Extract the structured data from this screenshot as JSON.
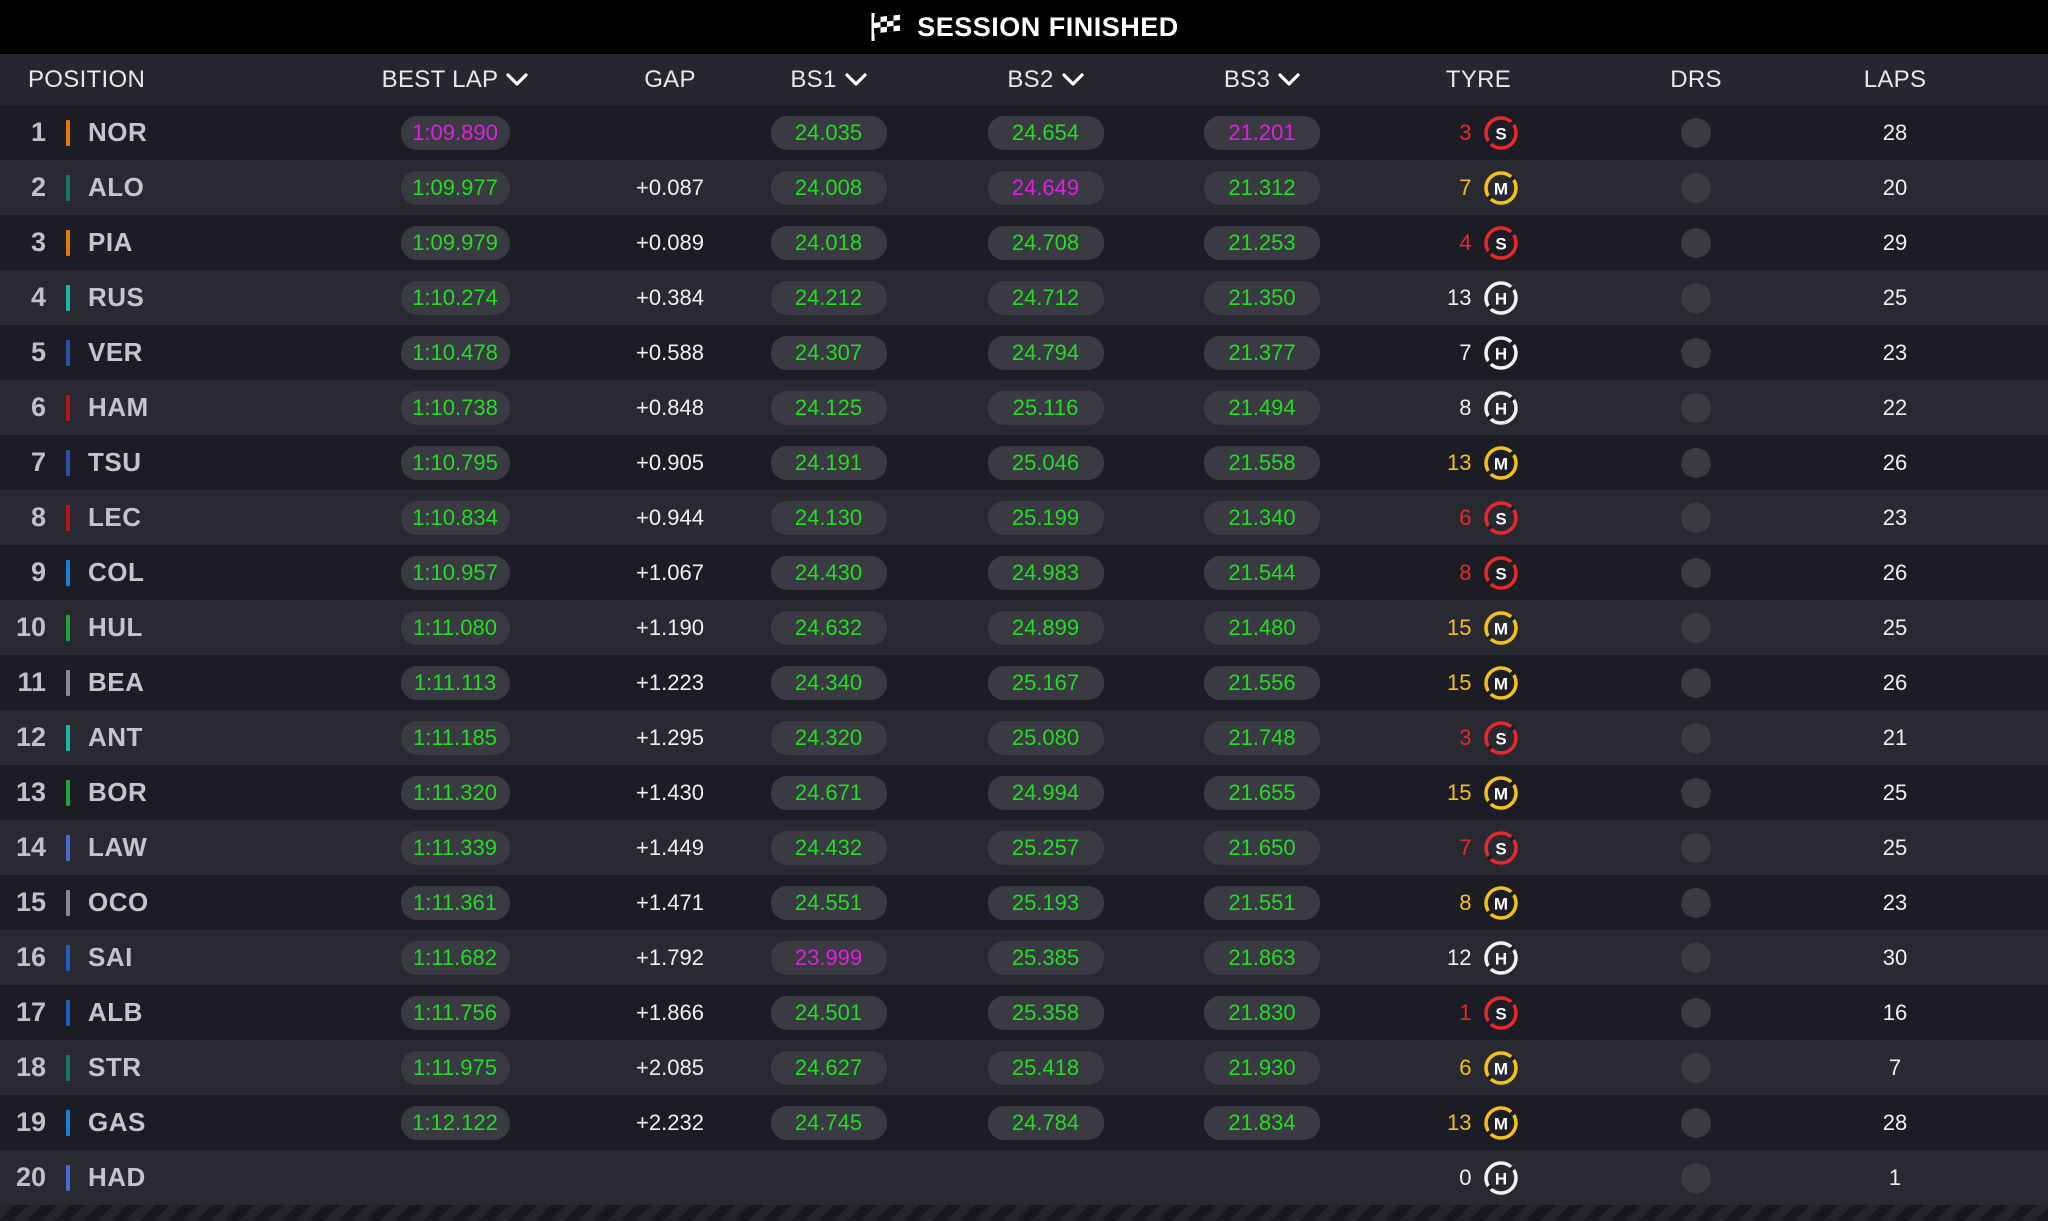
{
  "banner": {
    "title": "SESSION FINISHED",
    "icon": "chequered-flag-icon"
  },
  "headers": {
    "position": "POSITION",
    "best_lap": "BEST LAP",
    "gap": "GAP",
    "bs1": "BS1",
    "bs2": "BS2",
    "bs3": "BS3",
    "tyre": "TYRE",
    "drs": "DRS",
    "laps": "LAPS"
  },
  "compounds": {
    "S": {
      "color": "#e8282b"
    },
    "M": {
      "color": "#f2c11a"
    },
    "H": {
      "color": "#f2f2f2"
    }
  },
  "colors": {
    "personal_best": "#22dd22",
    "overall_best": "#e11fe1"
  },
  "rows": [
    {
      "pos": "1",
      "driver": "NOR",
      "team_color": "#e07a12",
      "best_lap": "1:09.890",
      "best_purple": true,
      "gap": "",
      "bs1": "24.035",
      "bs1_purple": false,
      "bs2": "24.654",
      "bs2_purple": false,
      "bs3": "21.201",
      "bs3_purple": true,
      "tyre_laps": "3",
      "compound": "S",
      "laps": "28"
    },
    {
      "pos": "2",
      "driver": "ALO",
      "team_color": "#137a5e",
      "best_lap": "1:09.977",
      "best_purple": false,
      "gap": "+0.087",
      "bs1": "24.008",
      "bs1_purple": false,
      "bs2": "24.649",
      "bs2_purple": true,
      "bs3": "21.312",
      "bs3_purple": false,
      "tyre_laps": "7",
      "compound": "M",
      "laps": "20"
    },
    {
      "pos": "3",
      "driver": "PIA",
      "team_color": "#e07a12",
      "best_lap": "1:09.979",
      "best_purple": false,
      "gap": "+0.089",
      "bs1": "24.018",
      "bs1_purple": false,
      "bs2": "24.708",
      "bs2_purple": false,
      "bs3": "21.253",
      "bs3_purple": false,
      "tyre_laps": "4",
      "compound": "S",
      "laps": "29"
    },
    {
      "pos": "4",
      "driver": "RUS",
      "team_color": "#1fb5a5",
      "best_lap": "1:10.274",
      "best_purple": false,
      "gap": "+0.384",
      "bs1": "24.212",
      "bs1_purple": false,
      "bs2": "24.712",
      "bs2_purple": false,
      "bs3": "21.350",
      "bs3_purple": false,
      "tyre_laps": "13",
      "compound": "H",
      "laps": "25"
    },
    {
      "pos": "5",
      "driver": "VER",
      "team_color": "#2c4fa8",
      "best_lap": "1:10.478",
      "best_purple": false,
      "gap": "+0.588",
      "bs1": "24.307",
      "bs1_purple": false,
      "bs2": "24.794",
      "bs2_purple": false,
      "bs3": "21.377",
      "bs3_purple": false,
      "tyre_laps": "7",
      "compound": "H",
      "laps": "23"
    },
    {
      "pos": "6",
      "driver": "HAM",
      "team_color": "#b3151d",
      "best_lap": "1:10.738",
      "best_purple": false,
      "gap": "+0.848",
      "bs1": "24.125",
      "bs1_purple": false,
      "bs2": "25.116",
      "bs2_purple": false,
      "bs3": "21.494",
      "bs3_purple": false,
      "tyre_laps": "8",
      "compound": "H",
      "laps": "22"
    },
    {
      "pos": "7",
      "driver": "TSU",
      "team_color": "#2c4fa8",
      "best_lap": "1:10.795",
      "best_purple": false,
      "gap": "+0.905",
      "bs1": "24.191",
      "bs1_purple": false,
      "bs2": "25.046",
      "bs2_purple": false,
      "bs3": "21.558",
      "bs3_purple": false,
      "tyre_laps": "13",
      "compound": "M",
      "laps": "26"
    },
    {
      "pos": "8",
      "driver": "LEC",
      "team_color": "#b3151d",
      "best_lap": "1:10.834",
      "best_purple": false,
      "gap": "+0.944",
      "bs1": "24.130",
      "bs1_purple": false,
      "bs2": "25.199",
      "bs2_purple": false,
      "bs3": "21.340",
      "bs3_purple": false,
      "tyre_laps": "6",
      "compound": "S",
      "laps": "23"
    },
    {
      "pos": "9",
      "driver": "COL",
      "team_color": "#1e7fd0",
      "best_lap": "1:10.957",
      "best_purple": false,
      "gap": "+1.067",
      "bs1": "24.430",
      "bs1_purple": false,
      "bs2": "24.983",
      "bs2_purple": false,
      "bs3": "21.544",
      "bs3_purple": false,
      "tyre_laps": "8",
      "compound": "S",
      "laps": "26"
    },
    {
      "pos": "10",
      "driver": "HUL",
      "team_color": "#20a33a",
      "best_lap": "1:11.080",
      "best_purple": false,
      "gap": "+1.190",
      "bs1": "24.632",
      "bs1_purple": false,
      "bs2": "24.899",
      "bs2_purple": false,
      "bs3": "21.480",
      "bs3_purple": false,
      "tyre_laps": "15",
      "compound": "M",
      "laps": "25"
    },
    {
      "pos": "11",
      "driver": "BEA",
      "team_color": "#8a8a92",
      "best_lap": "1:11.113",
      "best_purple": false,
      "gap": "+1.223",
      "bs1": "24.340",
      "bs1_purple": false,
      "bs2": "25.167",
      "bs2_purple": false,
      "bs3": "21.556",
      "bs3_purple": false,
      "tyre_laps": "15",
      "compound": "M",
      "laps": "26"
    },
    {
      "pos": "12",
      "driver": "ANT",
      "team_color": "#1fb5a5",
      "best_lap": "1:11.185",
      "best_purple": false,
      "gap": "+1.295",
      "bs1": "24.320",
      "bs1_purple": false,
      "bs2": "25.080",
      "bs2_purple": false,
      "bs3": "21.748",
      "bs3_purple": false,
      "tyre_laps": "3",
      "compound": "S",
      "laps": "21"
    },
    {
      "pos": "13",
      "driver": "BOR",
      "team_color": "#20a33a",
      "best_lap": "1:11.320",
      "best_purple": false,
      "gap": "+1.430",
      "bs1": "24.671",
      "bs1_purple": false,
      "bs2": "24.994",
      "bs2_purple": false,
      "bs3": "21.655",
      "bs3_purple": false,
      "tyre_laps": "15",
      "compound": "M",
      "laps": "25"
    },
    {
      "pos": "14",
      "driver": "LAW",
      "team_color": "#4a6ad0",
      "best_lap": "1:11.339",
      "best_purple": false,
      "gap": "+1.449",
      "bs1": "24.432",
      "bs1_purple": false,
      "bs2": "25.257",
      "bs2_purple": false,
      "bs3": "21.650",
      "bs3_purple": false,
      "tyre_laps": "7",
      "compound": "S",
      "laps": "25"
    },
    {
      "pos": "15",
      "driver": "OCO",
      "team_color": "#8a8a92",
      "best_lap": "1:11.361",
      "best_purple": false,
      "gap": "+1.471",
      "bs1": "24.551",
      "bs1_purple": false,
      "bs2": "25.193",
      "bs2_purple": false,
      "bs3": "21.551",
      "bs3_purple": false,
      "tyre_laps": "8",
      "compound": "M",
      "laps": "23"
    },
    {
      "pos": "16",
      "driver": "SAI",
      "team_color": "#1e5fc0",
      "best_lap": "1:11.682",
      "best_purple": false,
      "gap": "+1.792",
      "bs1": "23.999",
      "bs1_purple": true,
      "bs2": "25.385",
      "bs2_purple": false,
      "bs3": "21.863",
      "bs3_purple": false,
      "tyre_laps": "12",
      "compound": "H",
      "laps": "30"
    },
    {
      "pos": "17",
      "driver": "ALB",
      "team_color": "#1e5fc0",
      "best_lap": "1:11.756",
      "best_purple": false,
      "gap": "+1.866",
      "bs1": "24.501",
      "bs1_purple": false,
      "bs2": "25.358",
      "bs2_purple": false,
      "bs3": "21.830",
      "bs3_purple": false,
      "tyre_laps": "1",
      "compound": "S",
      "laps": "16"
    },
    {
      "pos": "18",
      "driver": "STR",
      "team_color": "#137a5e",
      "best_lap": "1:11.975",
      "best_purple": false,
      "gap": "+2.085",
      "bs1": "24.627",
      "bs1_purple": false,
      "bs2": "25.418",
      "bs2_purple": false,
      "bs3": "21.930",
      "bs3_purple": false,
      "tyre_laps": "6",
      "compound": "M",
      "laps": "7"
    },
    {
      "pos": "19",
      "driver": "GAS",
      "team_color": "#1e7fd0",
      "best_lap": "1:12.122",
      "best_purple": false,
      "gap": "+2.232",
      "bs1": "24.745",
      "bs1_purple": false,
      "bs2": "24.784",
      "bs2_purple": false,
      "bs3": "21.834",
      "bs3_purple": false,
      "tyre_laps": "13",
      "compound": "M",
      "laps": "28"
    },
    {
      "pos": "20",
      "driver": "HAD",
      "team_color": "#4a6ad0",
      "best_lap": "",
      "best_purple": false,
      "gap": "",
      "bs1": "",
      "bs1_purple": false,
      "bs2": "",
      "bs2_purple": false,
      "bs3": "",
      "bs3_purple": false,
      "tyre_laps": "0",
      "compound": "H",
      "laps": "1"
    }
  ]
}
